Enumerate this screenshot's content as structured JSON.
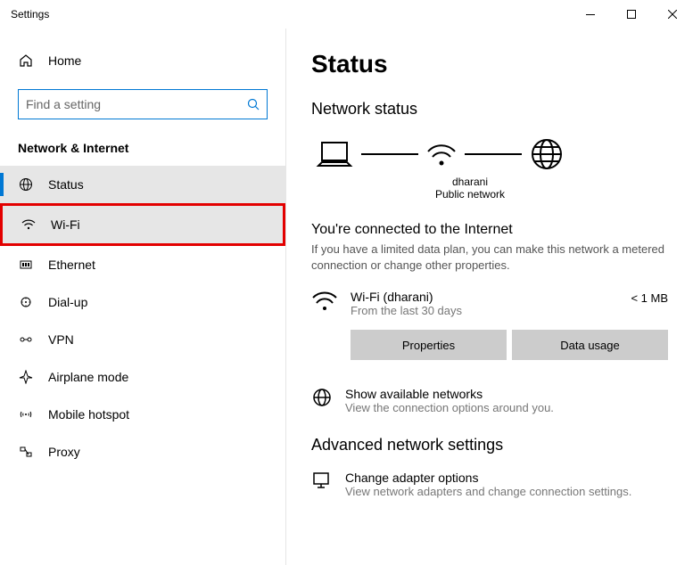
{
  "window": {
    "title": "Settings"
  },
  "sidebar": {
    "home": "Home",
    "searchPlaceholder": "Find a setting",
    "category": "Network & Internet",
    "items": [
      {
        "label": "Status"
      },
      {
        "label": "Wi-Fi"
      },
      {
        "label": "Ethernet"
      },
      {
        "label": "Dial-up"
      },
      {
        "label": "VPN"
      },
      {
        "label": "Airplane mode"
      },
      {
        "label": "Mobile hotspot"
      },
      {
        "label": "Proxy"
      }
    ]
  },
  "main": {
    "title": "Status",
    "section": "Network status",
    "diagram": {
      "networkName": "dharani",
      "networkType": "Public network"
    },
    "connected": {
      "title": "You're connected to the Internet",
      "desc": "If you have a limited data plan, you can make this network a metered connection or change other properties."
    },
    "connection": {
      "name": "Wi-Fi (dharani)",
      "sub": "From the last 30 days",
      "usage": "< 1 MB"
    },
    "buttons": {
      "properties": "Properties",
      "dataUsage": "Data usage"
    },
    "availableNetworks": {
      "title": "Show available networks",
      "sub": "View the connection options around you."
    },
    "advanced": {
      "title": "Advanced network settings",
      "adapter": {
        "title": "Change adapter options",
        "sub": "View network adapters and change connection settings."
      }
    }
  }
}
